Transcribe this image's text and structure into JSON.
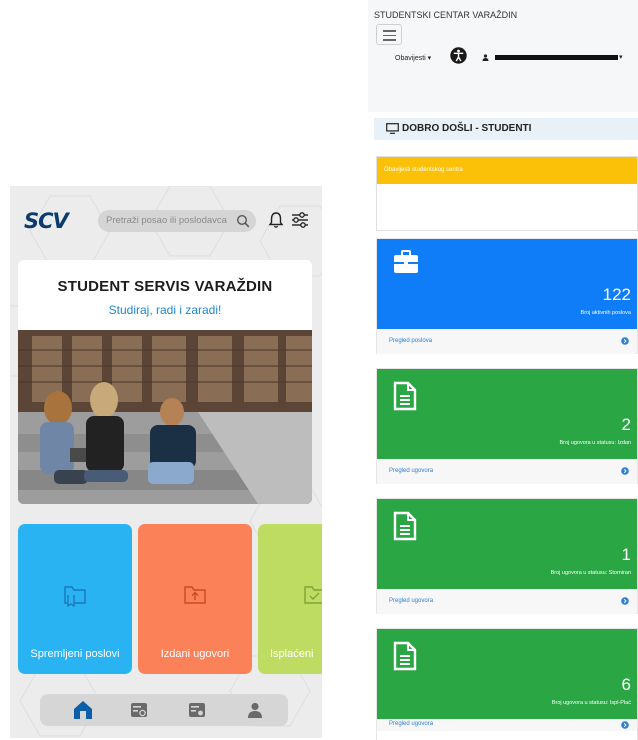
{
  "app": {
    "logo": "SCV",
    "search_placeholder": "Pretraži posao ili poslodavca",
    "hero_title": "STUDENT SERVIS VARAŽDIN",
    "hero_subtitle": "Studiraj, radi i zaradi!",
    "tiles": [
      {
        "label": "Spremljeni poslovi",
        "icon": "folder-bookmark-icon",
        "color": "#29b3f2"
      },
      {
        "label": "Izdani ugovori",
        "icon": "folder-upload-icon",
        "color": "#fb8158"
      },
      {
        "label": "Isplaćeni",
        "icon": "folder-check-icon",
        "color": "#bfdc62"
      }
    ],
    "nav_icons": [
      "home-icon",
      "job-search-icon",
      "contract-settings-icon",
      "profile-icon"
    ],
    "accent": "#0c3b6e"
  },
  "portal": {
    "site_title": "STUDENTSKI CENTAR VARAŽDIN",
    "notifications_label": "Obavijesti",
    "welcome": "DOBRO DOŠLI - STUDENTI",
    "notice_title": "Obavijesti studentskog centra",
    "cards": [
      {
        "value": "122",
        "caption": "Broj aktivnih poslova",
        "link": "Pregled poslova",
        "color": "#0f7df7",
        "icon": "briefcase-icon"
      },
      {
        "value": "2",
        "caption": "Broj ugovora u statusu: Izdan",
        "link": "Pregled ugovora",
        "color": "#2aa744",
        "icon": "document-icon"
      },
      {
        "value": "1",
        "caption": "Broj ugovora u statusu: Storniran",
        "link": "Pregled ugovora",
        "color": "#2aa744",
        "icon": "document-icon"
      },
      {
        "value": "6",
        "caption": "Broj ugovora u statusu: Ispl-Plać",
        "link": "Pregled ugovora",
        "color": "#2aa744",
        "icon": "document-icon"
      }
    ]
  }
}
